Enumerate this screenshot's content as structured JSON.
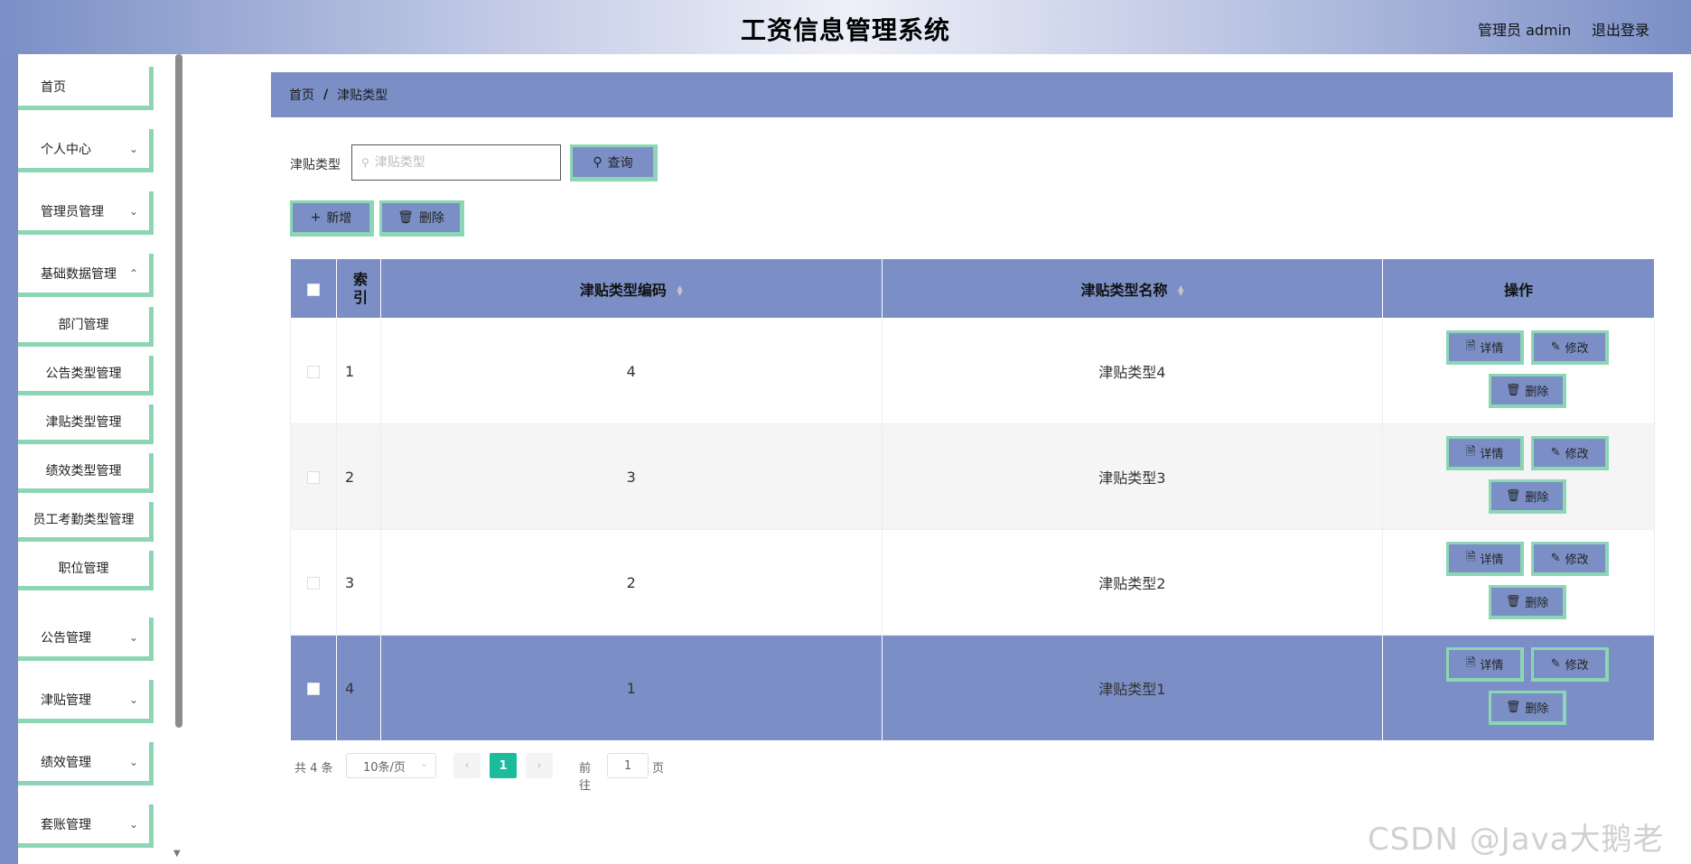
{
  "header": {
    "title": "工资信息管理系统",
    "user": "管理员 admin",
    "logout": "退出登录"
  },
  "sidebar": {
    "items": [
      {
        "label": "首页",
        "chevron": false
      },
      {
        "label": "个人中心",
        "chevron": true
      },
      {
        "label": "管理员管理",
        "chevron": true
      },
      {
        "label": "基础数据管理",
        "chevron": true
      },
      {
        "label": "公告管理",
        "chevron": true
      },
      {
        "label": "津贴管理",
        "chevron": true
      },
      {
        "label": "绩效管理",
        "chevron": true
      },
      {
        "label": "套账管理",
        "chevron": true
      }
    ],
    "subitems": [
      "部门管理",
      "公告类型管理",
      "津贴类型管理",
      "绩效类型管理",
      "员工考勤类型管理",
      "职位管理"
    ]
  },
  "breadcrumb": {
    "home": "首页",
    "separator": "/",
    "current": "津贴类型"
  },
  "search": {
    "label": "津贴类型",
    "placeholder": "津贴类型",
    "query_button": "查询"
  },
  "toolbar": {
    "add_button": "新增",
    "delete_button": "删除"
  },
  "table": {
    "headers": {
      "index": "索引",
      "code": "津贴类型编码",
      "name": "津贴类型名称",
      "ops": "操作"
    },
    "rows": [
      {
        "index": "1",
        "code": "4",
        "name": "津贴类型4"
      },
      {
        "index": "2",
        "code": "3",
        "name": "津贴类型3"
      },
      {
        "index": "3",
        "code": "2",
        "name": "津贴类型2"
      },
      {
        "index": "4",
        "code": "1",
        "name": "津贴类型1"
      }
    ],
    "op_labels": {
      "detail": "详情",
      "edit": "修改",
      "delete": "删除"
    }
  },
  "pagination": {
    "total": "共 4 条",
    "page_size": "10条/页",
    "current_page": "1",
    "goto_prefix": "前往",
    "goto_value": "1",
    "goto_suffix": "页"
  },
  "watermark": "CSDN @Java大鹅老师",
  "colors": {
    "primary": "#7b8fc6",
    "accent_border": "#8cd6b4",
    "page_active": "#1abc9c"
  }
}
